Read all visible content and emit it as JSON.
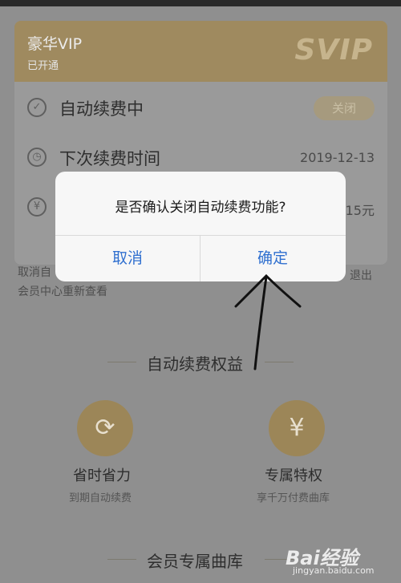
{
  "vip_card": {
    "title": "豪华VIP",
    "status": "已开通",
    "logo_text": "SVIP"
  },
  "rows": {
    "auto_renew": {
      "label": "自动续费中",
      "button": "关闭"
    },
    "next_renew": {
      "label": "下次续费时间",
      "value": "2019-12-13"
    },
    "amount": {
      "value": "15元"
    }
  },
  "note": {
    "left": "取消自",
    "right": "退出",
    "line2": "会员中心重新查看"
  },
  "benefits_section": {
    "title": "自动续费权益",
    "items": [
      {
        "title": "省时省力",
        "desc": "到期自动续费"
      },
      {
        "title": "专属特权",
        "desc": "享千万付费曲库"
      }
    ]
  },
  "library_section": {
    "title": "会员专属曲库"
  },
  "dialog": {
    "message": "是否确认关闭自动续费功能?",
    "cancel": "取消",
    "confirm": "确定"
  },
  "watermark": {
    "logo": "Bai经验",
    "site": "jingyan.baidu.com"
  },
  "colors": {
    "overlay_bg": "#8f8f8f",
    "gold": "#9f8a5f",
    "dialog_bg": "#f7f7f7",
    "dialog_button": "#2f6fcf"
  },
  "icons": [
    "check-circle-icon",
    "clock-icon",
    "yen-icon",
    "refresh-clock-icon",
    "yen-coin-icon",
    "arrow-annotation-icon"
  ]
}
